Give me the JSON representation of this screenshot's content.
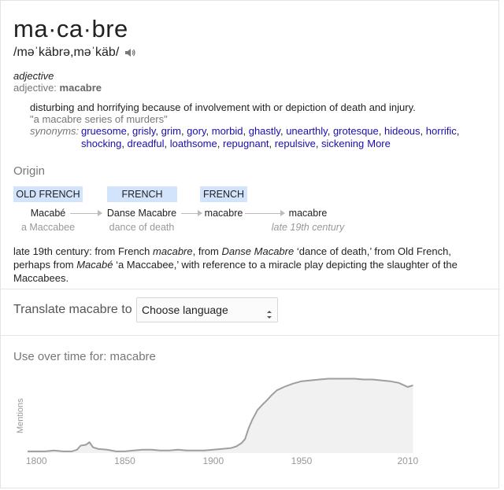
{
  "entry": {
    "word": "ma·ca·bre",
    "pronunciation": "/məˈkäbrə,məˈkäb/",
    "part_of_speech": "adjective",
    "pos_form_label": "adjective:",
    "pos_form_word": "macabre",
    "definition": "disturbing and horrifying because of involvement with or depiction of death and injury.",
    "example": "\"a macabre series of murders\"",
    "synonyms_label": "synonyms:",
    "synonyms": [
      "gruesome",
      "grisly",
      "grim",
      "gory",
      "morbid",
      "ghastly",
      "unearthly",
      "grotesque",
      "hideous",
      "horrific",
      "shocking",
      "dreadful",
      "loathsome",
      "repugnant",
      "repulsive",
      "sickening"
    ],
    "more_label": "More"
  },
  "origin": {
    "heading": "Origin",
    "languages": [
      "OLD FRENCH",
      "FRENCH",
      "FRENCH"
    ],
    "steps": [
      {
        "word": "Macabé",
        "gloss": "a Maccabee"
      },
      {
        "word": "Danse Macabre",
        "gloss": "dance of death"
      },
      {
        "word": "macabre",
        "gloss": ""
      },
      {
        "word": "macabre",
        "gloss": "late 19th century"
      }
    ],
    "text_1": "late 19th century: from French ",
    "text_2": "macabre",
    "text_3": ", from ",
    "text_4": "Danse Macabre",
    "text_5": " ‘dance of death,’ from Old French, perhaps from ",
    "text_6": "Macabé",
    "text_7": " ‘a Maccabee,’ with reference to a miracle play depicting the slaughter of the Maccabees."
  },
  "translate": {
    "label": "Translate macabre to",
    "selected": "Choose language"
  },
  "usage": {
    "heading": "Use over time for: macabre",
    "y_label": "Mentions"
  },
  "chart_data": {
    "type": "area",
    "title": "Use over time for: macabre",
    "ylabel": "Mentions",
    "xlabel": "",
    "x_ticks": [
      1800,
      1850,
      1900,
      1950,
      2010
    ],
    "xlim": [
      1795,
      2015
    ],
    "ylim": [
      0,
      100
    ],
    "grid": false,
    "color": "#9e9e9e",
    "fill": "#f1f1f1",
    "series": [
      {
        "x": [
          1795,
          1800,
          1805,
          1810,
          1815,
          1820,
          1823,
          1825,
          1828,
          1830,
          1832,
          1835,
          1840,
          1845,
          1850,
          1855,
          1860,
          1865,
          1870,
          1875,
          1880,
          1885,
          1890,
          1895,
          1900,
          1905,
          1910,
          1913,
          1916,
          1918,
          1920,
          1922,
          1925,
          1928,
          1930,
          1933,
          1936,
          1940,
          1945,
          1950,
          1955,
          1960,
          1965,
          1970,
          1975,
          1980,
          1985,
          1990,
          1995,
          2000,
          2005,
          2010,
          2013
        ],
        "y": [
          2,
          2,
          2,
          3,
          2,
          2,
          4,
          9,
          10,
          13,
          7,
          5,
          4,
          2,
          2,
          3,
          4,
          4,
          3,
          3,
          4,
          3,
          3,
          3,
          4,
          5,
          6,
          8,
          12,
          17,
          30,
          40,
          52,
          59,
          63,
          70,
          76,
          80,
          84,
          87,
          88,
          89,
          90,
          90,
          90,
          90,
          89,
          89,
          88,
          87,
          85,
          80,
          82
        ]
      }
    ]
  }
}
